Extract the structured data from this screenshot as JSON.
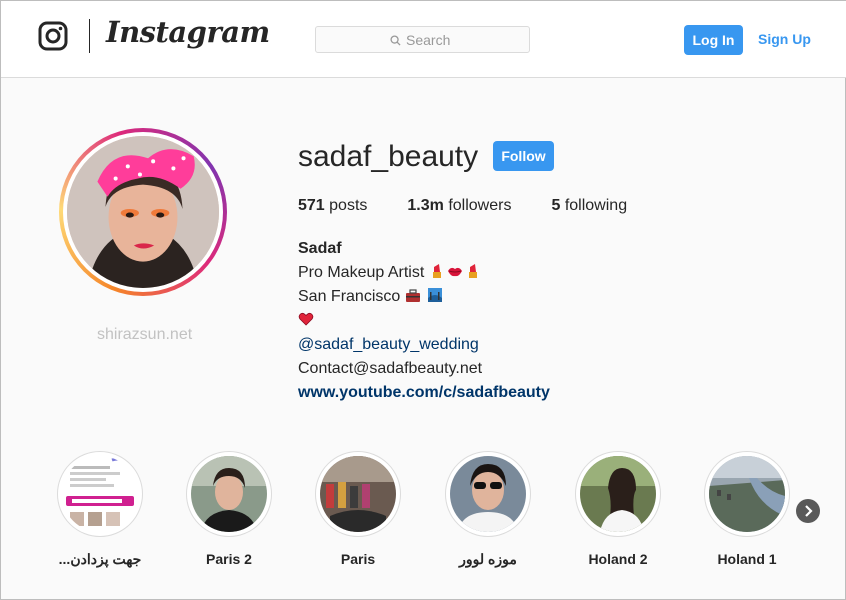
{
  "header": {
    "brand": "Instagram",
    "search_placeholder": "Search",
    "login_label": "Log In",
    "signup_label": "Sign Up"
  },
  "profile": {
    "username": "sadaf_beauty",
    "follow_label": "Follow",
    "stats": [
      {
        "value": "571",
        "label": "posts"
      },
      {
        "value": "1.3m",
        "label": "followers"
      },
      {
        "value": "5",
        "label": "following"
      }
    ],
    "full_name": "Sadaf",
    "bio_line1": "Pro Makeup Artist",
    "bio_line2": "San Francisco",
    "mention": "@sadaf_beauty_wedding",
    "contact": "Contact@sadafbeauty.net",
    "website": "www.youtube.com/c/sadafbeauty"
  },
  "watermark": "shirazsun.net",
  "highlights": [
    {
      "label": "...جهت پزدادن"
    },
    {
      "label": "Paris 2"
    },
    {
      "label": "Paris"
    },
    {
      "label": "موزه لوور"
    },
    {
      "label": "Holand 2"
    },
    {
      "label": "Holand 1"
    }
  ],
  "colors": {
    "accent": "#3897f0",
    "link_dark": "#003569",
    "text": "#262626",
    "border": "#dbdbdb"
  },
  "icons": [
    "instagram-glyph-icon",
    "search-icon",
    "lipstick-icon",
    "lips-icon",
    "makeup-case-icon",
    "bridge-photo-icon",
    "heart-icon",
    "chevron-right-icon"
  ]
}
